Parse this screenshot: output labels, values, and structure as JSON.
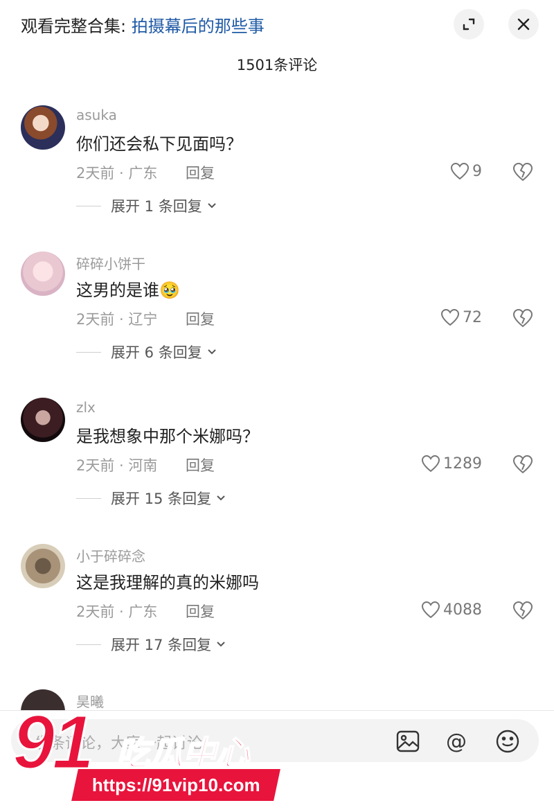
{
  "header": {
    "collection_prefix": "观看完整合集: ",
    "collection_link": "拍摄幕后的那些事",
    "expand_icon": "expand-icon",
    "close_icon": "close-icon"
  },
  "comment_count": "1501条评论",
  "comments": [
    {
      "username": "asuka",
      "text": "你们还会私下见面吗？",
      "meta": "2天前 · 广东",
      "reply_label": "回复",
      "likes": "9",
      "expand_label": "展开 1 条回复"
    },
    {
      "username": "碎碎小饼干",
      "text": "这男的是谁🥹",
      "meta": "2天前 · 辽宁",
      "reply_label": "回复",
      "likes": "72",
      "expand_label": "展开 6 条回复"
    },
    {
      "username": "zlx",
      "text": "是我想象中那个米娜吗？",
      "meta": "2天前 · 河南",
      "reply_label": "回复",
      "likes": "1289",
      "expand_label": "展开 15 条回复"
    },
    {
      "username": "小于碎碎念",
      "text": "这是我理解的真的米娜吗",
      "meta": "2天前 · 广东",
      "reply_label": "回复",
      "likes": "4088",
      "expand_label": "展开 17 条回复"
    }
  ],
  "partial_comment": {
    "username": "昊曦"
  },
  "input": {
    "placeholder": "发条评论，大家一起讨论"
  },
  "watermark": {
    "number": "91",
    "title": "吃瓜中心",
    "url": "https://91vip10.com"
  },
  "colors": {
    "link": "#1f5aa6",
    "brand_red": "#e8143c",
    "muted": "#9a9a9a"
  }
}
